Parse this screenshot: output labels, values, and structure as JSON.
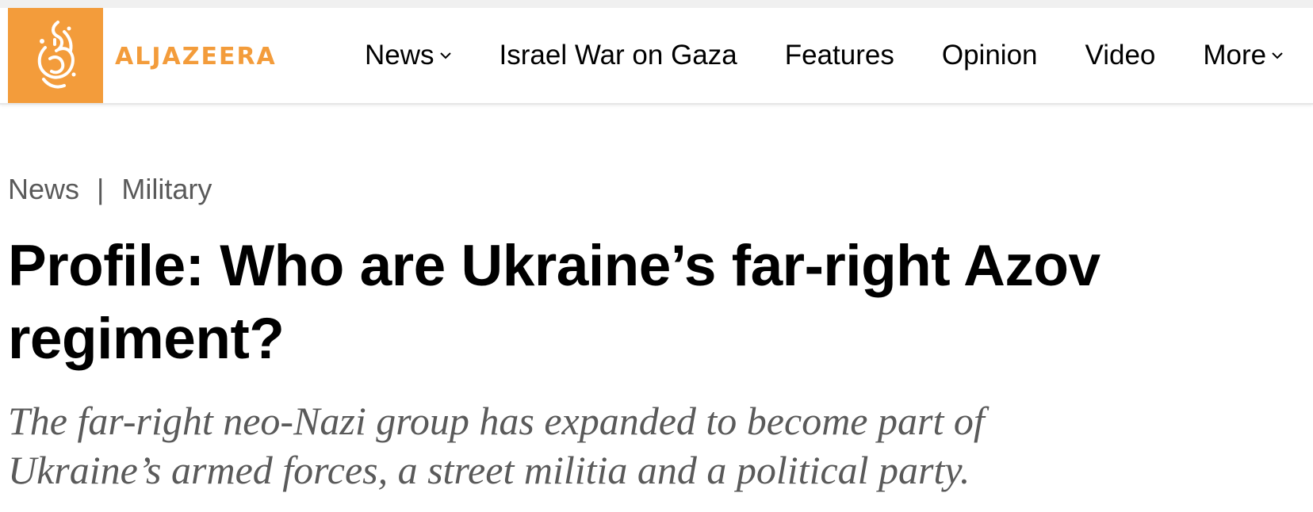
{
  "brand": {
    "name": "ALJAZEERA",
    "accent_color": "#f39c3b",
    "logo_icon": "aljazeera-calligraphy-logo"
  },
  "nav": {
    "items": [
      {
        "label": "News",
        "has_dropdown": true
      },
      {
        "label": "Israel War on Gaza",
        "has_dropdown": false
      },
      {
        "label": "Features",
        "has_dropdown": false
      },
      {
        "label": "Opinion",
        "has_dropdown": false
      },
      {
        "label": "Video",
        "has_dropdown": false
      },
      {
        "label": "More",
        "has_dropdown": true
      }
    ]
  },
  "breadcrumb": {
    "section": "News",
    "separator": "|",
    "topic": "Military"
  },
  "article": {
    "headline": "Profile: Who are Ukraine’s far-right Azov regiment?",
    "standfirst": "The far-right neo-Nazi group has expanded to become part of Ukraine’s armed forces, a street militia and a political party."
  }
}
